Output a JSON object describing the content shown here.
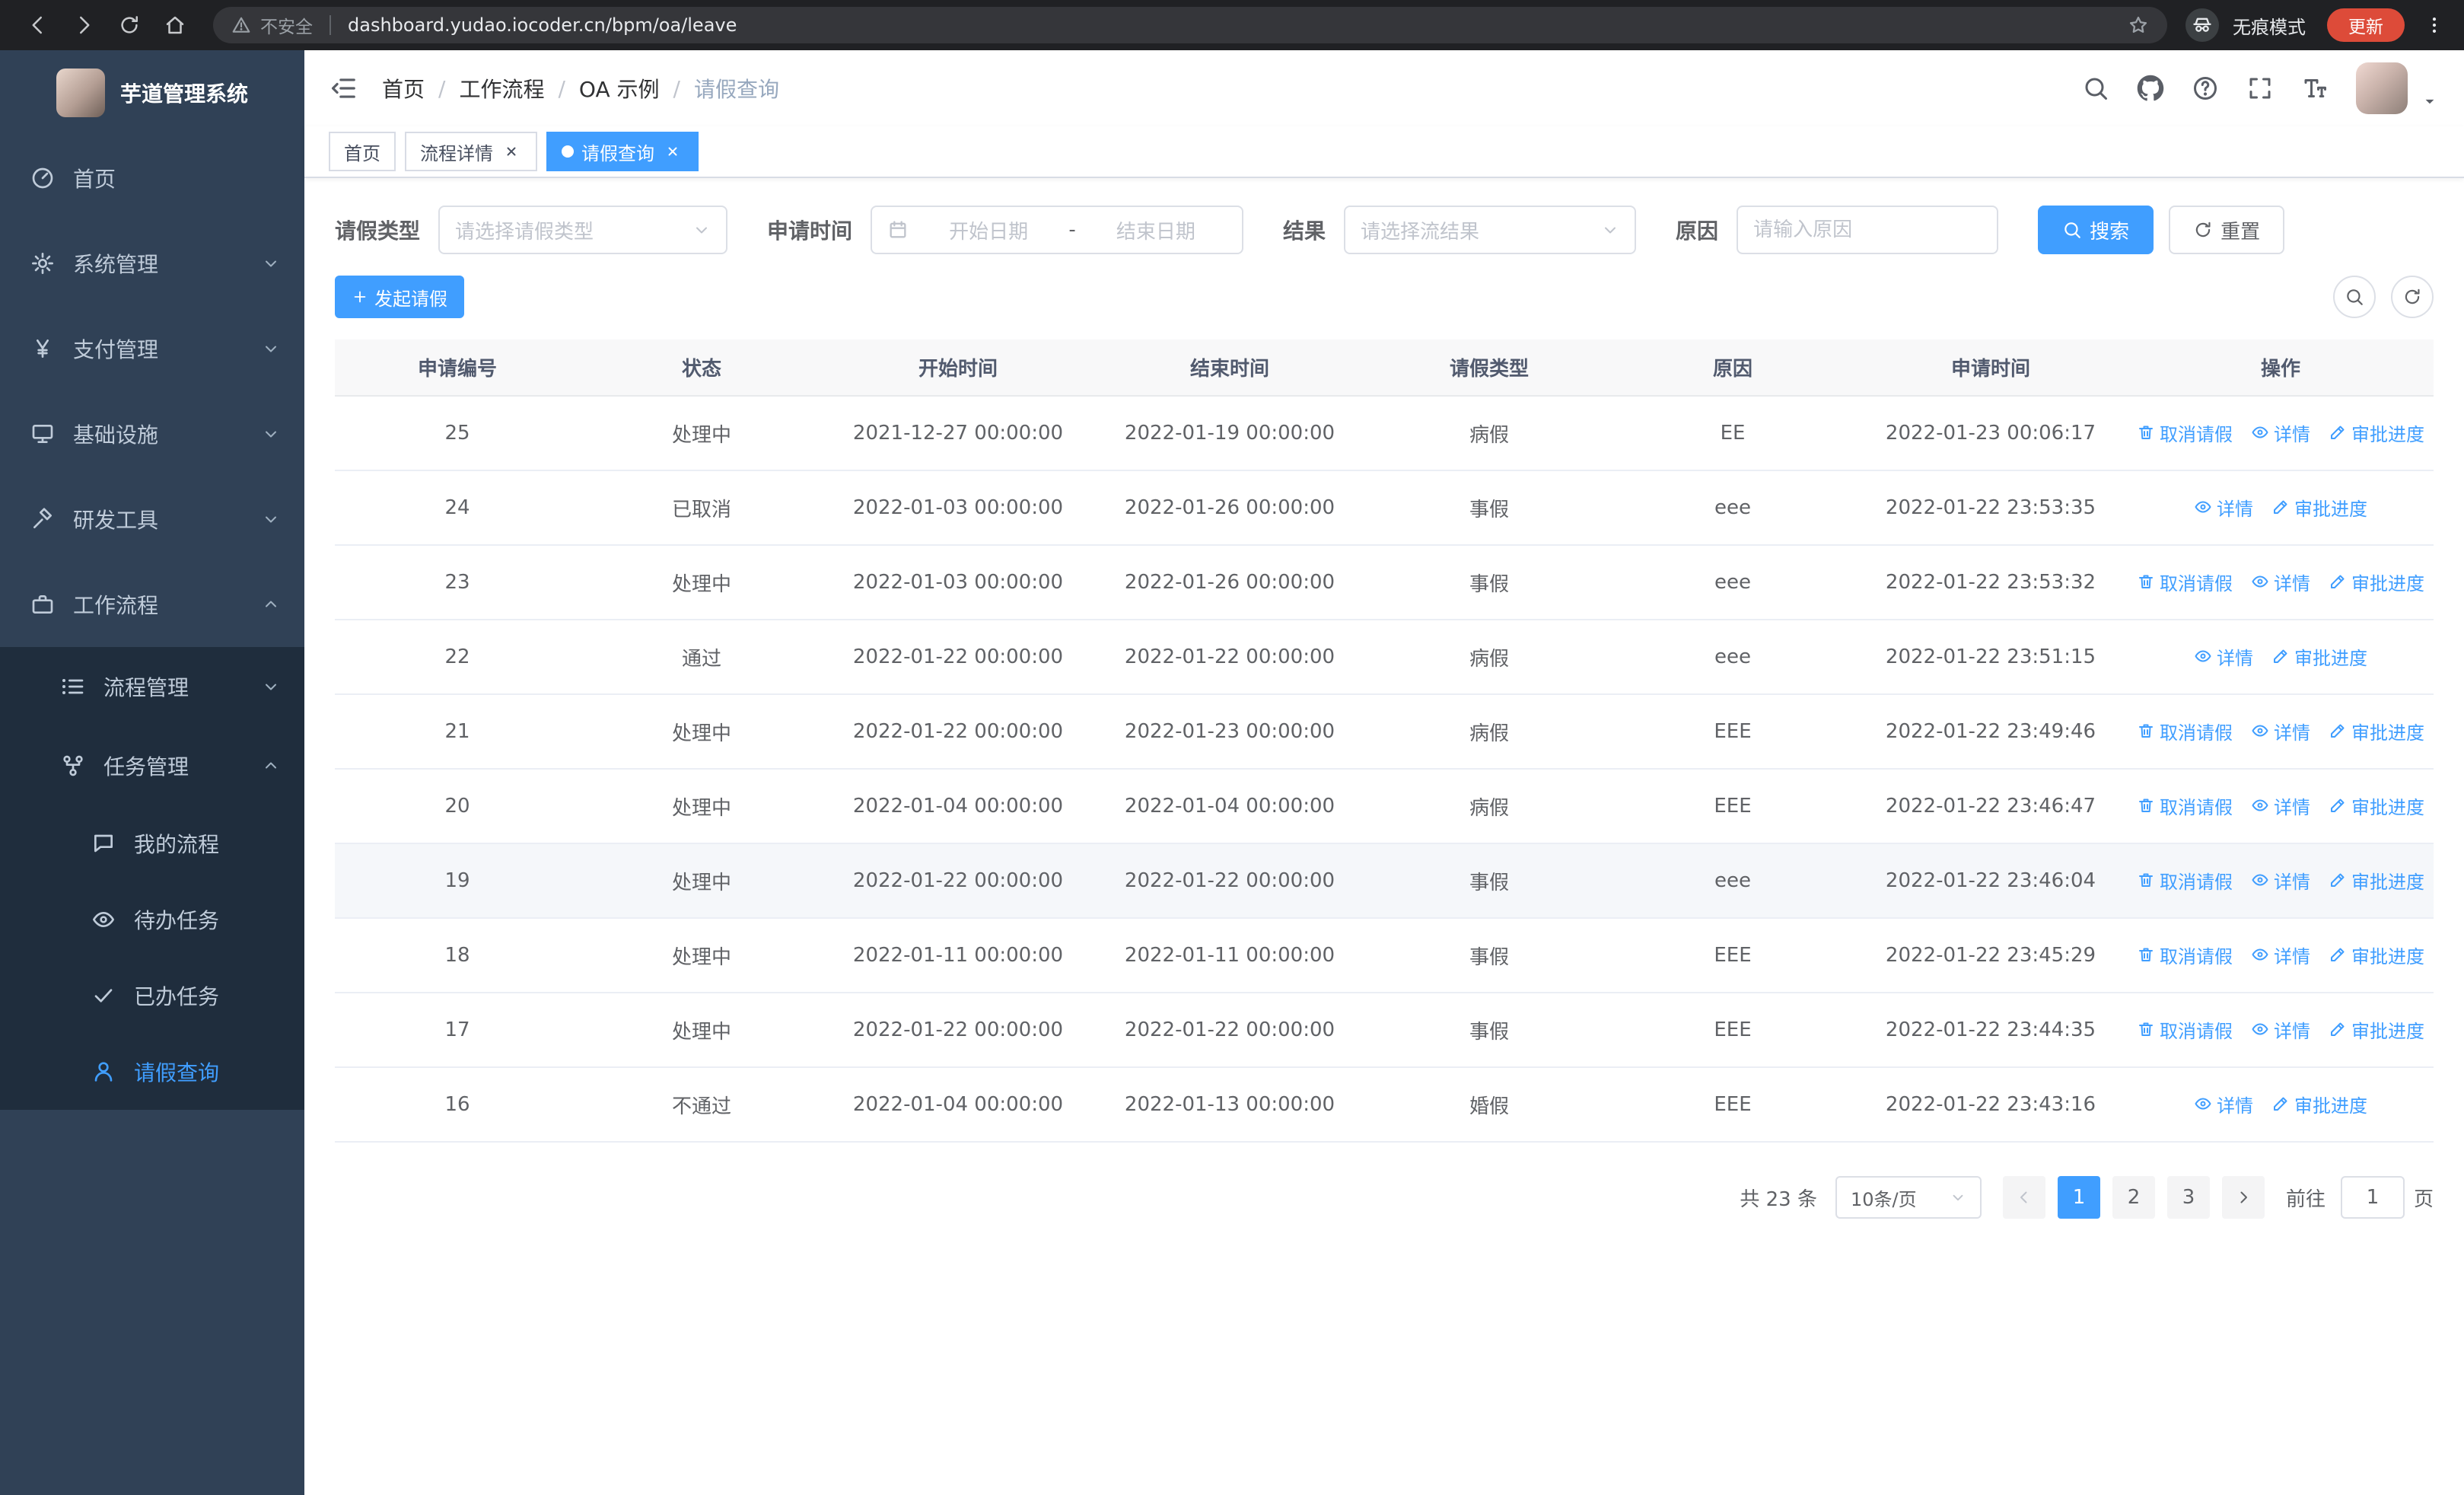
{
  "colors": {
    "primary": "#409eff",
    "sidebar_bg": "#304156",
    "submenu_bg": "#1f2d3d",
    "update_pill": "#dd4b39"
  },
  "browser": {
    "security_warning": "不安全",
    "url": "dashboard.yudao.iocoder.cn/bpm/oa/leave",
    "incognito_label": "无痕模式",
    "update_button": "更新"
  },
  "sidebar": {
    "logo_title": "芋道管理系统",
    "menu": [
      {
        "key": "home",
        "label": "首页",
        "icon": "dashboard"
      },
      {
        "key": "system",
        "label": "系统管理",
        "icon": "gear",
        "arrow": "down"
      },
      {
        "key": "payment",
        "label": "支付管理",
        "icon": "yen",
        "arrow": "down"
      },
      {
        "key": "infrastructure",
        "label": "基础设施",
        "icon": "monitor",
        "arrow": "down"
      },
      {
        "key": "devtools",
        "label": "研发工具",
        "icon": "tools",
        "arrow": "down"
      },
      {
        "key": "workflow",
        "label": "工作流程",
        "icon": "briefcase",
        "arrow": "up",
        "open": true,
        "children": [
          {
            "key": "process-mgmt",
            "label": "流程管理",
            "icon": "list",
            "arrow": "down"
          },
          {
            "key": "task-mgmt",
            "label": "任务管理",
            "icon": "org",
            "arrow": "up",
            "open": true,
            "children": [
              {
                "key": "my-process",
                "label": "我的流程",
                "icon": "chat"
              },
              {
                "key": "todo-tasks",
                "label": "待办任务",
                "icon": "eye"
              },
              {
                "key": "done-tasks",
                "label": "已办任务",
                "icon": "check"
              },
              {
                "key": "leave-query",
                "label": "请假查询",
                "icon": "user",
                "active": true
              }
            ]
          }
        ]
      }
    ]
  },
  "header": {
    "breadcrumb": [
      "首页",
      "工作流程",
      "OA 示例",
      "请假查询"
    ]
  },
  "tabs": [
    {
      "key": "home",
      "label": "首页",
      "closable": false,
      "active": false
    },
    {
      "key": "process-detail",
      "label": "流程详情",
      "closable": true,
      "active": false
    },
    {
      "key": "leave-query",
      "label": "请假查询",
      "closable": true,
      "active": true
    }
  ],
  "filters": {
    "leave_type_label": "请假类型",
    "leave_type_placeholder": "请选择请假类型",
    "apply_time_label": "申请时间",
    "start_date_placeholder": "开始日期",
    "date_separator": "-",
    "end_date_placeholder": "结束日期",
    "result_label": "结果",
    "result_placeholder": "请选择流结果",
    "reason_label": "原因",
    "reason_placeholder": "请输入原因",
    "search_button": "搜索",
    "reset_button": "重置"
  },
  "toolbar": {
    "create_button": "发起请假"
  },
  "table": {
    "columns": [
      "申请编号",
      "状态",
      "开始时间",
      "结束时间",
      "请假类型",
      "原因",
      "申请时间",
      "操作"
    ],
    "action_labels": {
      "cancel": "取消请假",
      "detail": "详情",
      "progress": "审批进度"
    },
    "rows": [
      {
        "id": "25",
        "status": "处理中",
        "start": "2021-12-27 00:00:00",
        "end": "2022-01-19 00:00:00",
        "type": "病假",
        "reason": "EE",
        "apply_time": "2022-01-23 00:06:17",
        "actions": [
          "cancel",
          "detail",
          "progress"
        ]
      },
      {
        "id": "24",
        "status": "已取消",
        "start": "2022-01-03 00:00:00",
        "end": "2022-01-26 00:00:00",
        "type": "事假",
        "reason": "eee",
        "apply_time": "2022-01-22 23:53:35",
        "actions": [
          "detail",
          "progress"
        ]
      },
      {
        "id": "23",
        "status": "处理中",
        "start": "2022-01-03 00:00:00",
        "end": "2022-01-26 00:00:00",
        "type": "事假",
        "reason": "eee",
        "apply_time": "2022-01-22 23:53:32",
        "actions": [
          "cancel",
          "detail",
          "progress"
        ]
      },
      {
        "id": "22",
        "status": "通过",
        "start": "2022-01-22 00:00:00",
        "end": "2022-01-22 00:00:00",
        "type": "病假",
        "reason": "eee",
        "apply_time": "2022-01-22 23:51:15",
        "actions": [
          "detail",
          "progress"
        ]
      },
      {
        "id": "21",
        "status": "处理中",
        "start": "2022-01-22 00:00:00",
        "end": "2022-01-23 00:00:00",
        "type": "病假",
        "reason": "EEE",
        "apply_time": "2022-01-22 23:49:46",
        "actions": [
          "cancel",
          "detail",
          "progress"
        ]
      },
      {
        "id": "20",
        "status": "处理中",
        "start": "2022-01-04 00:00:00",
        "end": "2022-01-04 00:00:00",
        "type": "病假",
        "reason": "EEE",
        "apply_time": "2022-01-22 23:46:47",
        "actions": [
          "cancel",
          "detail",
          "progress"
        ]
      },
      {
        "id": "19",
        "status": "处理中",
        "start": "2022-01-22 00:00:00",
        "end": "2022-01-22 00:00:00",
        "type": "事假",
        "reason": "eee",
        "apply_time": "2022-01-22 23:46:04",
        "actions": [
          "cancel",
          "detail",
          "progress"
        ],
        "highlighted": true
      },
      {
        "id": "18",
        "status": "处理中",
        "start": "2022-01-11 00:00:00",
        "end": "2022-01-11 00:00:00",
        "type": "事假",
        "reason": "EEE",
        "apply_time": "2022-01-22 23:45:29",
        "actions": [
          "cancel",
          "detail",
          "progress"
        ]
      },
      {
        "id": "17",
        "status": "处理中",
        "start": "2022-01-22 00:00:00",
        "end": "2022-01-22 00:00:00",
        "type": "事假",
        "reason": "EEE",
        "apply_time": "2022-01-22 23:44:35",
        "actions": [
          "cancel",
          "detail",
          "progress"
        ]
      },
      {
        "id": "16",
        "status": "不通过",
        "start": "2022-01-04 00:00:00",
        "end": "2022-01-13 00:00:00",
        "type": "婚假",
        "reason": "EEE",
        "apply_time": "2022-01-22 23:43:16",
        "actions": [
          "detail",
          "progress"
        ]
      }
    ]
  },
  "pagination": {
    "total_text": "共 23 条",
    "page_size": "10条/页",
    "pages": [
      "1",
      "2",
      "3"
    ],
    "active_page": "1",
    "goto_label": "前往",
    "goto_value": "1",
    "goto_suffix": "页"
  }
}
